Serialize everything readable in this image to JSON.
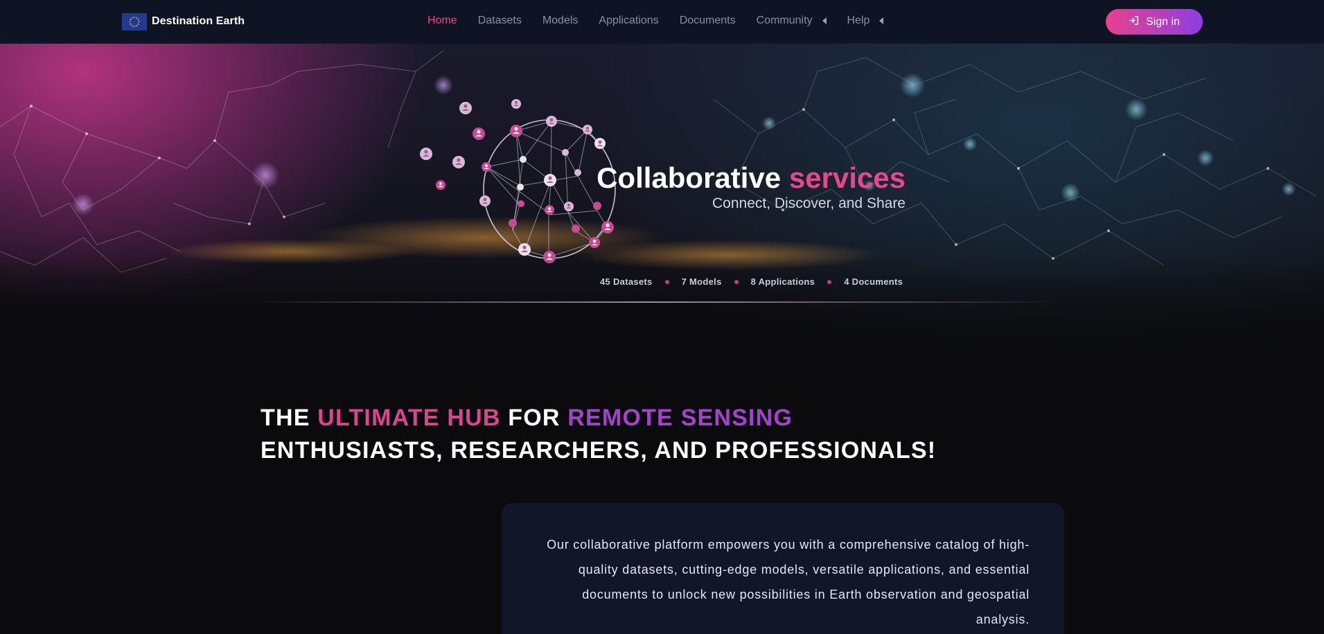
{
  "navbar": {
    "brand": "Destination Earth",
    "links": [
      {
        "label": "Home",
        "active": true
      },
      {
        "label": "Datasets"
      },
      {
        "label": "Models"
      },
      {
        "label": "Applications"
      },
      {
        "label": "Documents"
      },
      {
        "label": "Community",
        "dropdown": true
      },
      {
        "label": "Help",
        "dropdown": true
      }
    ],
    "signin_label": "Sign in",
    "signin_icon": "sign-in-icon"
  },
  "hero": {
    "title_main": "Collaborative",
    "title_accent": "services",
    "subtitle": "Connect, Discover, and Share",
    "stats": [
      "45 Datasets",
      "7 Models",
      "8 Applications",
      "4 Documents"
    ]
  },
  "intro": {
    "headline_parts": [
      "THE",
      "ULTIMATE HUB",
      "FOR",
      "REMOTE SENSING",
      "ENTHUSIASTS, RESEARCHERS, AND PROFESSIONALS!"
    ],
    "description": "Our collaborative platform empowers you with a comprehensive catalog of high-quality datasets, cutting-edge models, versatile applications, and essential documents to unlock new possibilities in Earth observation and geospatial analysis."
  },
  "colors": {
    "nav_bg": "#0f1424",
    "accent_pink": "#e8468f",
    "accent_purple": "#a144c9",
    "page_bg": "#0b0b0d",
    "card_bg": "#111729"
  }
}
